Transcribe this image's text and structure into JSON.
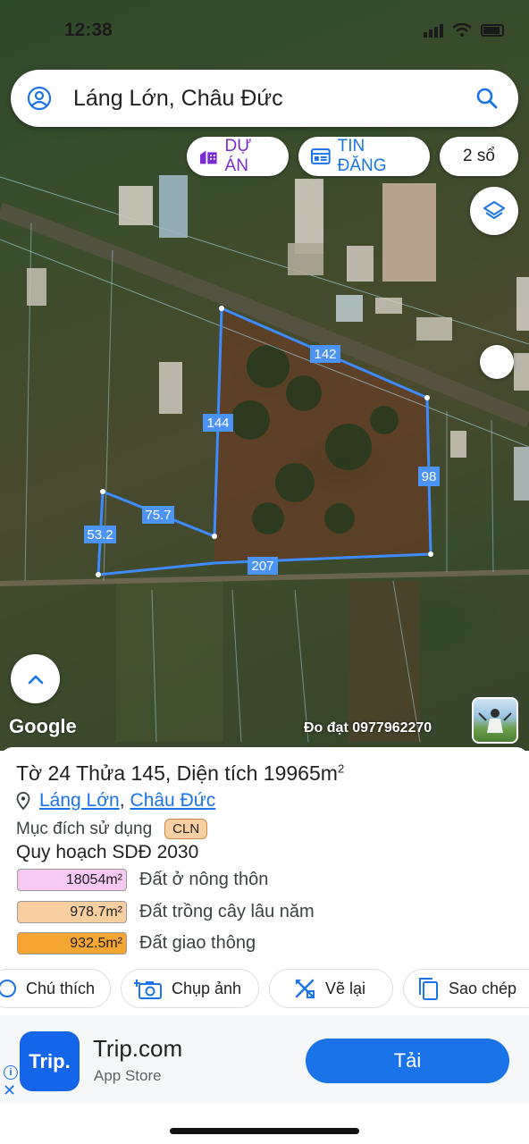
{
  "status_bar": {
    "time": "12:38"
  },
  "search": {
    "query": "Láng Lớn, Châu Đức"
  },
  "filters": {
    "du_an": "DỰ ÁN",
    "tin_dang": "TIN ĐĂNG",
    "so_count": "2 sổ"
  },
  "map": {
    "plot_edges": [
      "142",
      "144",
      "98",
      "207",
      "75.7",
      "53.2"
    ],
    "google_logo": "Google",
    "watermark": "Đo đạt 0977962270"
  },
  "parcel": {
    "title_prefix": "Tờ 24 Thửa 145, Diện tích 19965m",
    "title_sup": "2",
    "location_village": "Láng Lớn",
    "location_sep": ",",
    "location_district": "Châu Đức",
    "purpose_label": "Mục đích sử dụng",
    "purpose_code": "CLN",
    "plan_title": "Quy hoạch SDĐ 2030",
    "zones": [
      {
        "area": "18054m²",
        "name": "Đất ở nông thôn",
        "color": "#f6c9f2"
      },
      {
        "area": "978.7m²",
        "name": "Đất trồng cây lâu năm",
        "color": "#f8cfa0"
      },
      {
        "area": "932.5m²",
        "name": "Đất giao thông",
        "color": "#f5a531"
      }
    ]
  },
  "actions": {
    "legend": "Chú thích",
    "capture": "Chụp ảnh",
    "redraw": "Vẽ lại",
    "copy": "Sao chép"
  },
  "ad": {
    "logo_text": "Trip.",
    "name": "Trip.com",
    "store": "App Store",
    "cta": "Tải",
    "info": "i",
    "close": "✕"
  },
  "colors": {
    "accent": "#1a73e8",
    "plot_line": "#3d8bff",
    "purple": "#7b2bd1"
  }
}
